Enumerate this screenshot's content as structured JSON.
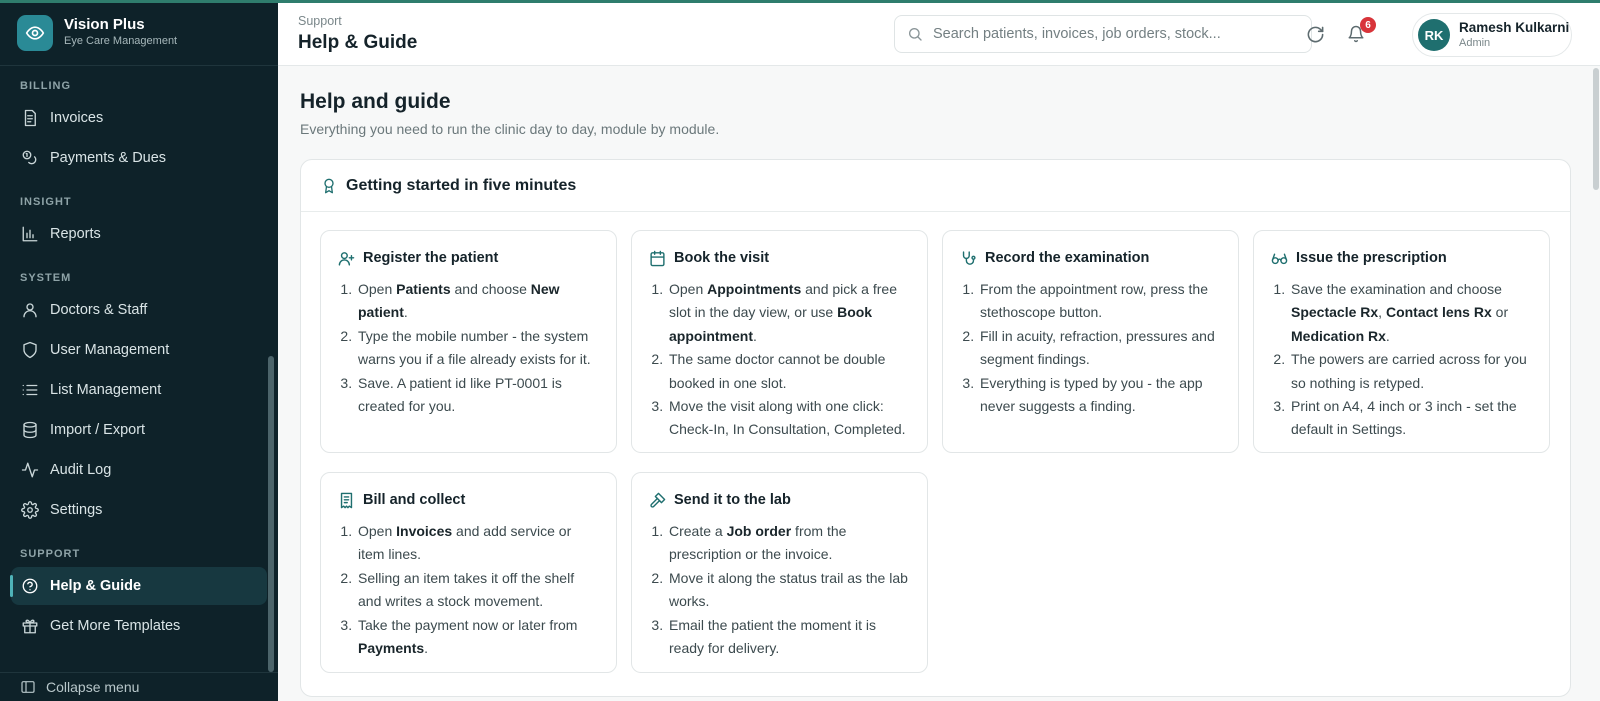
{
  "brand": {
    "name": "Vision Plus",
    "subtitle": "Eye Care Management"
  },
  "sidebar": {
    "sections": [
      {
        "label": "BILLING",
        "items": [
          {
            "label": "Invoices",
            "icon": "invoice-icon"
          },
          {
            "label": "Payments & Dues",
            "icon": "coins-icon"
          }
        ]
      },
      {
        "label": "INSIGHT",
        "items": [
          {
            "label": "Reports",
            "icon": "bar-chart-icon"
          }
        ]
      },
      {
        "label": "SYSTEM",
        "items": [
          {
            "label": "Doctors & Staff",
            "icon": "user-icon"
          },
          {
            "label": "User Management",
            "icon": "shield-icon"
          },
          {
            "label": "List Management",
            "icon": "list-icon"
          },
          {
            "label": "Import / Export",
            "icon": "database-icon"
          },
          {
            "label": "Audit Log",
            "icon": "activity-icon"
          },
          {
            "label": "Settings",
            "icon": "gear-icon"
          }
        ]
      },
      {
        "label": "SUPPORT",
        "items": [
          {
            "label": "Help & Guide",
            "icon": "help-circle-icon",
            "active": true
          },
          {
            "label": "Get More Templates",
            "icon": "gift-icon"
          }
        ]
      }
    ],
    "collapse_label": "Collapse menu"
  },
  "header": {
    "breadcrumb": "Support",
    "title": "Help & Guide",
    "search_placeholder": "Search patients, invoices, job orders, stock...",
    "notification_count": "6",
    "user": {
      "initials": "RK",
      "name": "Ramesh Kulkarni",
      "role": "Admin"
    }
  },
  "page": {
    "title": "Help and guide",
    "subtitle": "Everything you need to run the clinic day to day, module by module.",
    "panel_title": "Getting started in five minutes"
  },
  "guides": [
    {
      "title": "Register the patient",
      "icon": "user-plus-icon",
      "steps": [
        [
          [
            "Open "
          ],
          [
            "Patients",
            true
          ],
          [
            " and choose "
          ],
          [
            "New patient",
            true
          ],
          [
            "."
          ]
        ],
        [
          [
            "Type the mobile number - the system warns you if a file already exists for it."
          ]
        ],
        [
          [
            "Save. A patient id like PT-0001 is created for you."
          ]
        ]
      ]
    },
    {
      "title": "Book the visit",
      "icon": "calendar-icon",
      "steps": [
        [
          [
            "Open "
          ],
          [
            "Appointments",
            true
          ],
          [
            " and pick a free slot in the day view, or use "
          ],
          [
            "Book appointment",
            true
          ],
          [
            "."
          ]
        ],
        [
          [
            "The same doctor cannot be double booked in one slot."
          ]
        ],
        [
          [
            "Move the visit along with one click: Check-In, In Consultation, Completed."
          ]
        ]
      ]
    },
    {
      "title": "Record the examination",
      "icon": "stethoscope-icon",
      "steps": [
        [
          [
            "From the appointment row, press the stethoscope button."
          ]
        ],
        [
          [
            "Fill in acuity, refraction, pressures and segment findings."
          ]
        ],
        [
          [
            "Everything is typed by you - the app never suggests a finding."
          ]
        ]
      ]
    },
    {
      "title": "Issue the prescription",
      "icon": "glasses-icon",
      "steps": [
        [
          [
            "Save the examination and choose "
          ],
          [
            "Spectacle Rx",
            true
          ],
          [
            ", "
          ],
          [
            "Contact lens Rx",
            true
          ],
          [
            " or "
          ],
          [
            "Medication Rx",
            true
          ],
          [
            "."
          ]
        ],
        [
          [
            "The powers are carried across for you so nothing is retyped."
          ]
        ],
        [
          [
            "Print on A4, 4 inch or 3 inch - set the default in Settings."
          ]
        ]
      ]
    },
    {
      "title": "Bill and collect",
      "icon": "receipt-icon",
      "steps": [
        [
          [
            "Open "
          ],
          [
            "Invoices",
            true
          ],
          [
            " and add service or item lines."
          ]
        ],
        [
          [
            "Selling an item takes it off the shelf and writes a stock movement."
          ]
        ],
        [
          [
            "Take the payment now or later from "
          ],
          [
            "Payments",
            true
          ],
          [
            "."
          ]
        ]
      ]
    },
    {
      "title": "Send it to the lab",
      "icon": "hammer-icon",
      "steps": [
        [
          [
            "Create a "
          ],
          [
            "Job order",
            true
          ],
          [
            " from the prescription or the invoice."
          ]
        ],
        [
          [
            "Move it along the status trail as the lab works."
          ]
        ],
        [
          [
            "Email the patient the moment it is ready for delivery."
          ]
        ]
      ]
    }
  ],
  "colors": {
    "sidebar_bg": "#0e2229",
    "accent": "#2a8a96",
    "badge": "#d8343a",
    "avatar": "#1f6f6f"
  }
}
